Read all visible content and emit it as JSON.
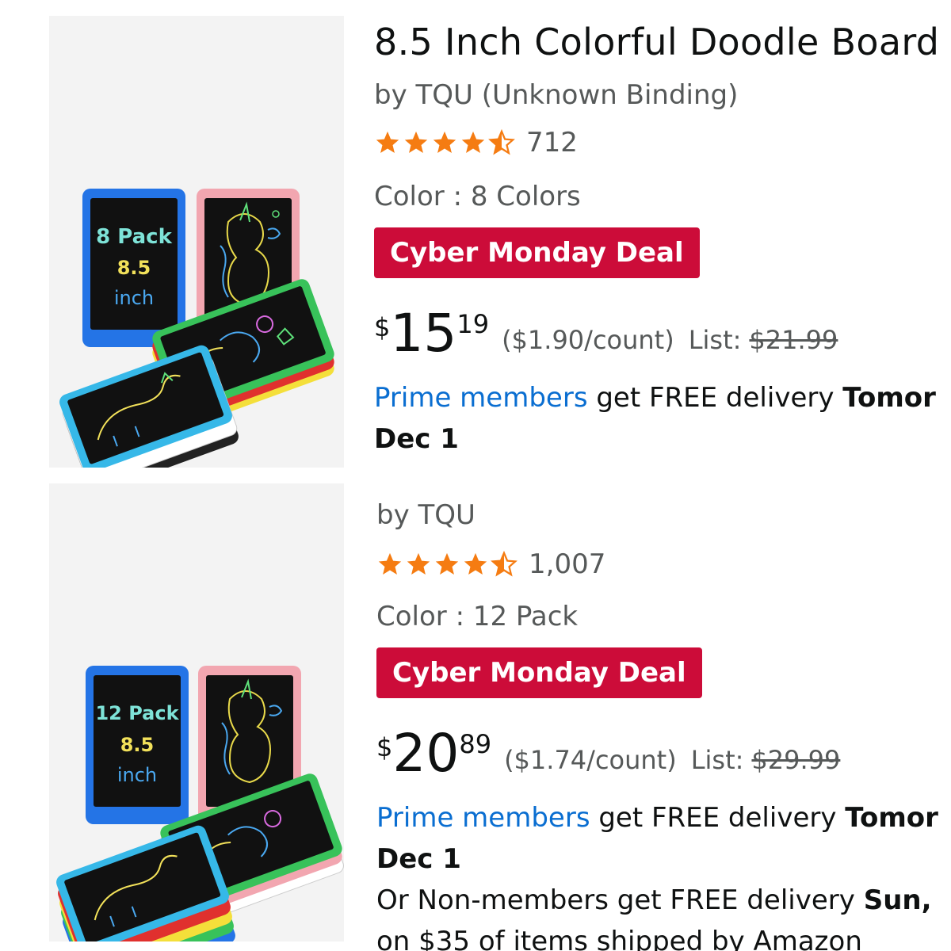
{
  "products": [
    {
      "title": "8.5 Inch Colorful Doodle Board",
      "byline": "by TQU (Unknown Binding)",
      "rating_value": 4.5,
      "rating_count": "712",
      "variant": "Color : 8 Colors",
      "badge": "Cyber Monday Deal",
      "price_currency": "$",
      "price_whole": "15",
      "price_fraction": "19",
      "unit_price": "($1.90/count)",
      "list_label": "List:",
      "list_price": "$21.99",
      "prime_link": "Prime members",
      "delivery_text": " get FREE delivery ",
      "delivery_day": "Tomor",
      "delivery_date": "Dec 1",
      "image": {
        "pack_label": "8 Pack",
        "size": "8.5",
        "size_unit": "inch"
      }
    },
    {
      "title": "",
      "byline": "by TQU",
      "rating_value": 4.5,
      "rating_count": "1,007",
      "variant": "Color : 12 Pack",
      "badge": "Cyber Monday Deal",
      "price_currency": "$",
      "price_whole": "20",
      "price_fraction": "89",
      "unit_price": "($1.74/count)",
      "list_label": "List:",
      "list_price": "$29.99",
      "prime_link": "Prime members",
      "delivery_text": " get FREE delivery ",
      "delivery_day": "Tomor",
      "delivery_date": "Dec 1",
      "nonmember_text": "Or Non-members get FREE delivery ",
      "nonmember_day": "Sun,",
      "threshold_text": "on $35 of items shipped by Amazon",
      "image": {
        "pack_label": "12 Pack",
        "size": "8.5",
        "size_unit": "inch"
      }
    }
  ],
  "colors": {
    "deal_red": "#cc0c39",
    "star_orange": "#f57c12",
    "link_blue": "#0a6ed1",
    "muted_text": "#565959"
  },
  "icons": {
    "star": "star-icon",
    "half_star": "half-star-icon"
  }
}
